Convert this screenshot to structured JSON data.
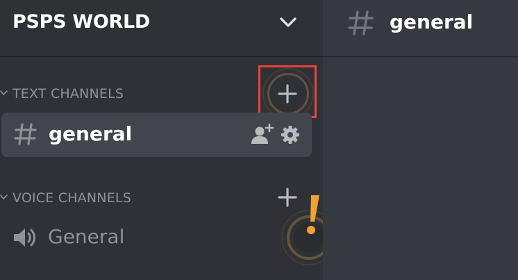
{
  "server": {
    "name": "PSPS WORLD"
  },
  "categories": [
    {
      "label": "TEXT CHANNELS"
    },
    {
      "label": "VOICE CHANNELS"
    }
  ],
  "text_channels": [
    {
      "name": "general",
      "selected": true
    }
  ],
  "voice_channels": [
    {
      "name": "General"
    }
  ],
  "main": {
    "channel_title": "general"
  },
  "icons": {
    "header_dropdown": "chevron-down-icon",
    "category_caret": "caret-down-icon",
    "add_channel": "plus-icon",
    "text_channel": "hash-icon",
    "invite": "add-member-icon",
    "settings": "gear-icon",
    "voice_channel": "speaker-icon",
    "tutorial_hint": "exclamation-icon"
  },
  "colors": {
    "sidebar_bg": "#2f3136",
    "main_bg": "#36393f",
    "selected_row_bg": "#42454b",
    "muted_text": "#8e9297",
    "bright_text": "#ffffff",
    "highlight_border": "#e8453a",
    "hint_accent": "#f0a332"
  }
}
